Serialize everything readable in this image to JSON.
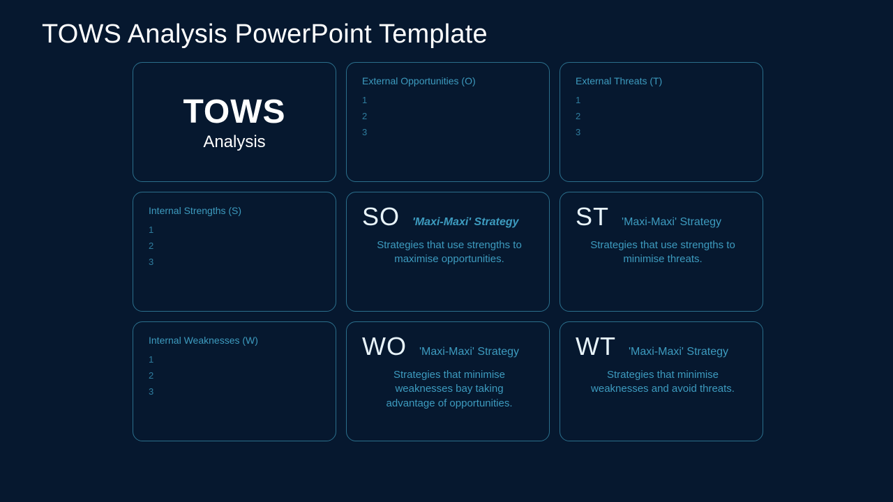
{
  "title": "TOWS Analysis PowerPoint Template",
  "corner": {
    "big": "TOWS",
    "sub": "Analysis"
  },
  "ext_opportunities": {
    "title": "External Opportunities (O)",
    "items": [
      "1",
      "2",
      "3"
    ]
  },
  "ext_threats": {
    "title": "External Threats (T)",
    "items": [
      "1",
      "2",
      "3"
    ]
  },
  "int_strengths": {
    "title": "Internal Strengths (S)",
    "items": [
      "1",
      "2",
      "3"
    ]
  },
  "int_weaknesses": {
    "title": "Internal Weaknesses (W)",
    "items": [
      "1",
      "2",
      "3"
    ]
  },
  "so": {
    "code": "SO",
    "label": "'Maxi-Maxi' Strategy",
    "desc": "Strategies that use strengths to maximise opportunities."
  },
  "st": {
    "code": "ST",
    "label": "'Maxi-Maxi' Strategy",
    "desc": "Strategies that use strengths to minimise threats."
  },
  "wo": {
    "code": "WO",
    "label": "'Maxi-Maxi' Strategy",
    "desc": "Strategies that minimise weaknesses bay taking advantage of opportunities."
  },
  "wt": {
    "code": "WT",
    "label": "'Maxi-Maxi' Strategy",
    "desc": "Strategies that minimise weaknesses and avoid threats."
  }
}
